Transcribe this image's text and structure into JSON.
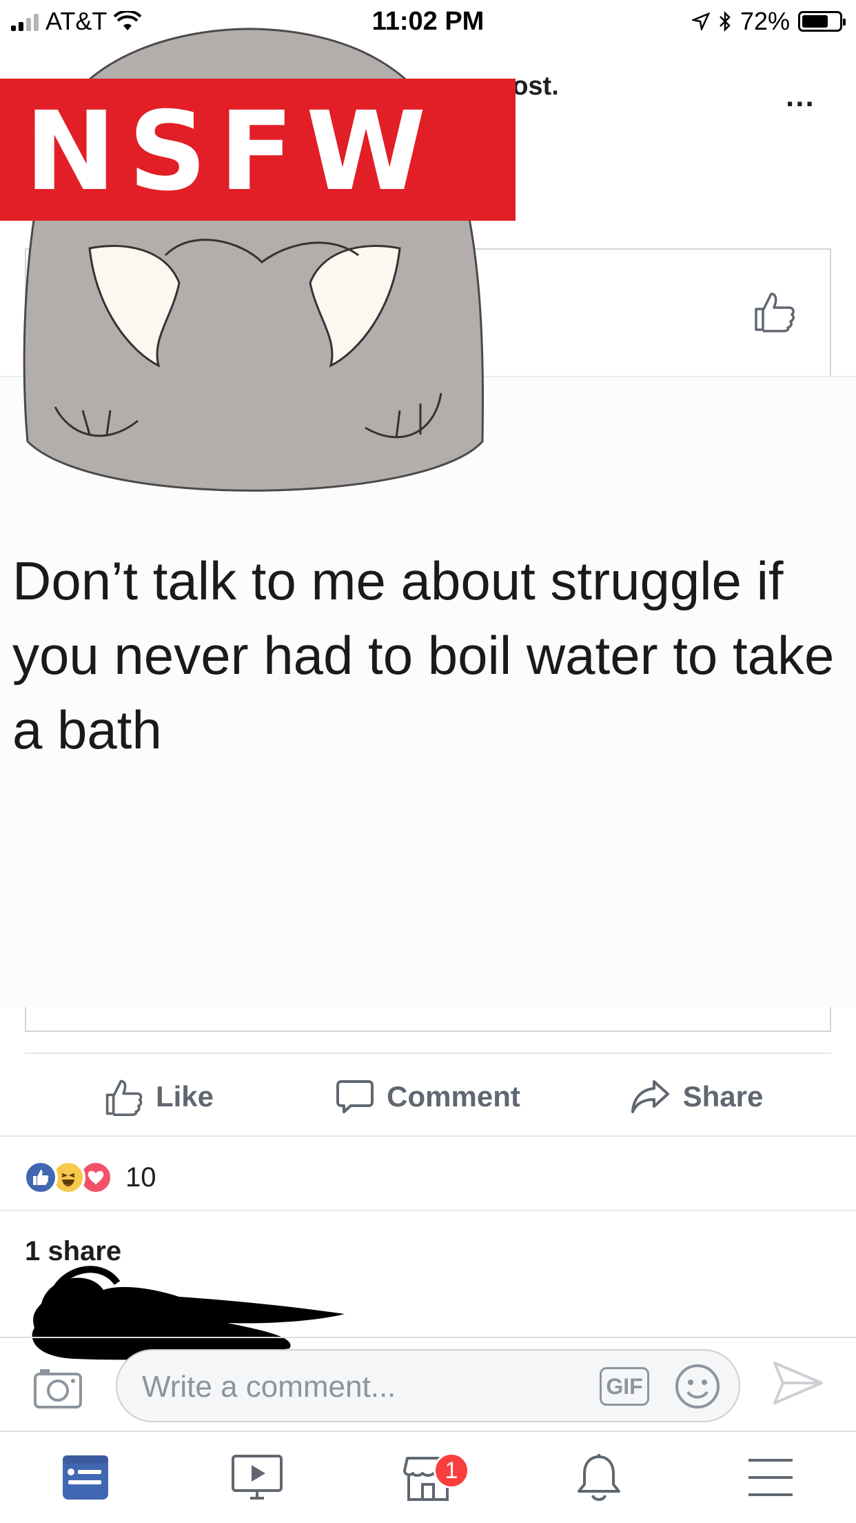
{
  "status_bar": {
    "carrier": "AT&T",
    "time": "11:02 PM",
    "battery_percent": "72%",
    "battery_level": 0.72
  },
  "post": {
    "header_fragment": "post.",
    "more_label": "...",
    "overlay_label": "NSFW",
    "meme_text": "Don’t talk to me about struggle if you never had to boil water to take a bath"
  },
  "actions": {
    "like": "Like",
    "comment": "Comment",
    "share": "Share"
  },
  "reactions": {
    "count": "10",
    "types": [
      "like-reaction-icon",
      "haha-reaction-icon",
      "love-reaction-icon"
    ]
  },
  "shares": {
    "label": "1 share"
  },
  "composer": {
    "placeholder": "Write a comment...",
    "gif_label": "GIF"
  },
  "tab_bar": {
    "items": [
      {
        "name": "news-feed-icon",
        "active": true
      },
      {
        "name": "watch-icon",
        "active": false
      },
      {
        "name": "marketplace-icon",
        "active": false,
        "badge": "1"
      },
      {
        "name": "notifications-icon",
        "active": false
      },
      {
        "name": "menu-icon",
        "active": false
      }
    ]
  },
  "colors": {
    "accent": "#4267b2",
    "nsfw_red": "#e21f26",
    "badge_red": "#fa3e3e",
    "text_secondary": "#606770"
  }
}
